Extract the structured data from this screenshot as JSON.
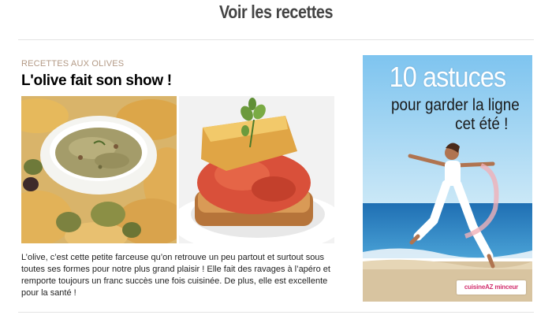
{
  "section": {
    "heading": "Voir les recettes"
  },
  "article": {
    "category": "RECETTES AUX OLIVES",
    "title": "L'olive fait son show !",
    "description": "L’olive, c’est cette petite farceuse qu’on retrouve un peu partout et surtout sous toutes ses formes pour notre plus grand plaisir ! Elle fait des ravages à l’apéro et remporte toujours un franc succès une fois cuisinée. De plus, elle est excellente pour la santé !",
    "images": [
      "olive-tapenade-photo",
      "toast-tomato-herb-photo"
    ]
  },
  "ad": {
    "line1": "10 astuces",
    "line2": "pour garder la ligne",
    "line3": "cet été !",
    "logo": "cuisineAZ minceur"
  },
  "colors": {
    "heading": "#444444",
    "category": "#b39a86",
    "sea": "#2f86c4",
    "sky": "#8ec9ec",
    "brand": "#d2316f"
  }
}
